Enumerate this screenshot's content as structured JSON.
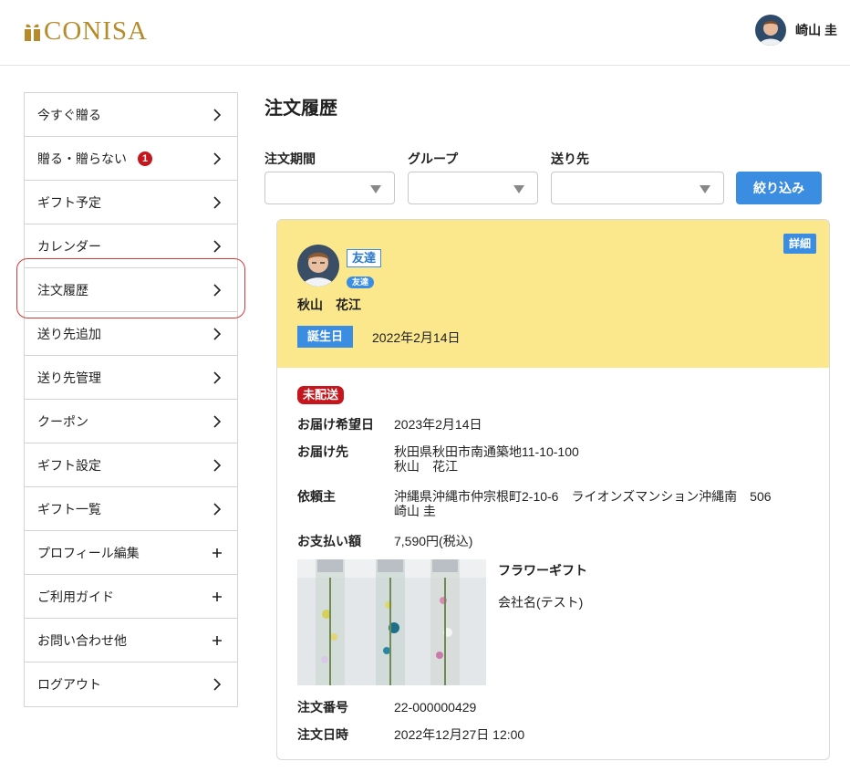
{
  "header": {
    "logo_text": "CONISA",
    "user_name": "崎山 圭"
  },
  "sidebar": {
    "items": [
      {
        "label": "今すぐ贈る",
        "icon": "chevron-right-icon"
      },
      {
        "label": "贈る・贈らない",
        "icon": "chevron-right-icon",
        "badge": "1"
      },
      {
        "label": "ギフト予定",
        "icon": "chevron-right-icon"
      },
      {
        "label": "カレンダー",
        "icon": "chevron-right-icon"
      },
      {
        "label": "注文履歴",
        "icon": "chevron-right-icon"
      },
      {
        "label": "送り先追加",
        "icon": "chevron-right-icon"
      },
      {
        "label": "送り先管理",
        "icon": "chevron-right-icon"
      },
      {
        "label": "クーポン",
        "icon": "chevron-right-icon"
      },
      {
        "label": "ギフト設定",
        "icon": "chevron-right-icon"
      },
      {
        "label": "ギフト一覧",
        "icon": "chevron-right-icon"
      },
      {
        "label": "プロフィール編集",
        "icon": "plus-icon"
      },
      {
        "label": "ご利用ガイド",
        "icon": "plus-icon"
      },
      {
        "label": "お問い合わせ他",
        "icon": "plus-icon"
      },
      {
        "label": "ログアウト",
        "icon": "chevron-right-icon"
      }
    ]
  },
  "main": {
    "title": "注文履歴",
    "filters": {
      "period_label": "注文期間",
      "group_label": "グループ",
      "recipient_label": "送り先",
      "period_value": "",
      "group_value": "",
      "recipient_value": "",
      "submit_label": "絞り込み"
    },
    "order": {
      "tag_outline": "友達",
      "tag_pill": "友達",
      "recipient_name": "秋山　花江",
      "birthday_label": "誕生日",
      "birthday_date": "2022年2月14日",
      "detail_label": "詳細",
      "status": "未配送",
      "desired_date_label": "お届け希望日",
      "desired_date": "2023年2月14日",
      "delivery_label": "お届け先",
      "delivery_address": "秋田県秋田市南通築地11-10-100",
      "delivery_name": "秋山　花江",
      "requester_label": "依頼主",
      "requester_address": "沖縄県沖縄市仲宗根町2-10-6　ライオンズマンション沖縄南　506",
      "requester_name": "崎山 圭",
      "payment_label": "お支払い額",
      "payment_amount": "7,590円(税込)",
      "product_name": "フラワーギフト",
      "product_company": "会社名(テスト)",
      "order_no_label": "注文番号",
      "order_no": "22-000000429",
      "order_date_label": "注文日時",
      "order_date": "2022年12月27日 12:00"
    }
  },
  "colors": {
    "accent": "#3a8de0",
    "status_red": "#c4161c",
    "card_header": "#fbe78c",
    "logo_gold": "#b68b2c"
  }
}
